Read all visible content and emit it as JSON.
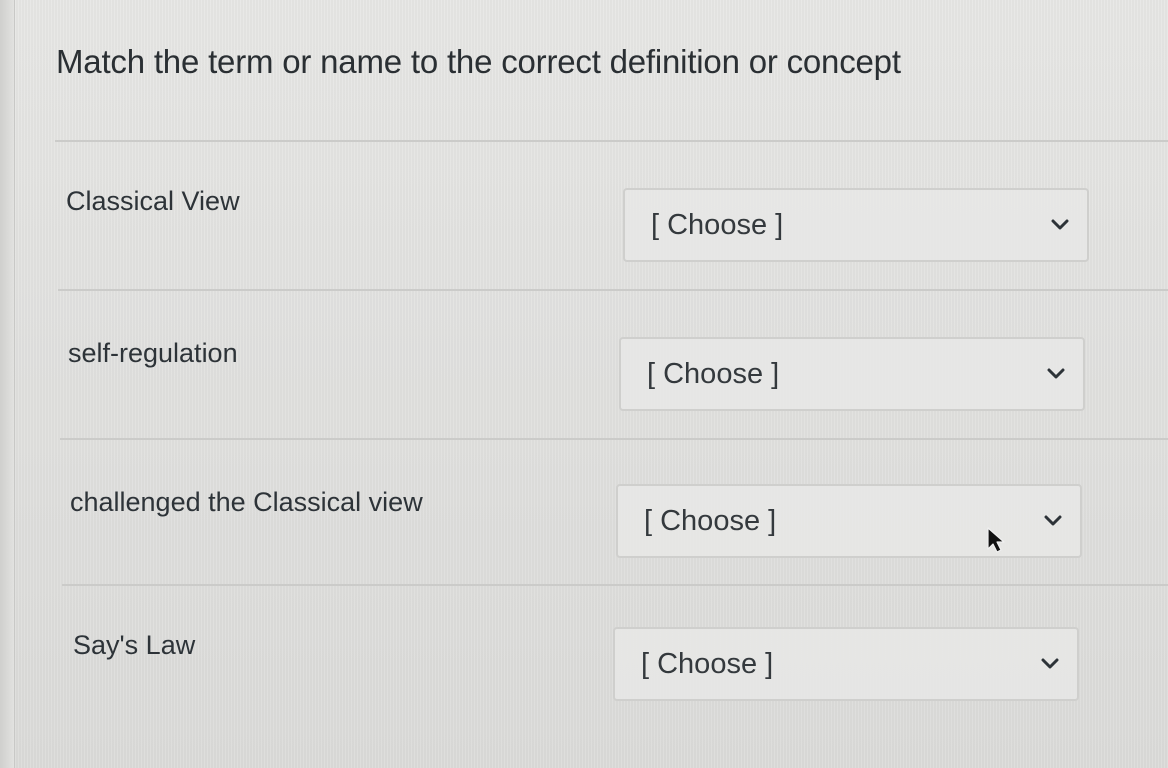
{
  "question": {
    "prompt": "Match the term or name to the correct definition or concept"
  },
  "rows": [
    {
      "term": "Classical View",
      "select_value": "[ Choose ]"
    },
    {
      "term": "self-regulation",
      "select_value": "[ Choose ]"
    },
    {
      "term": "challenged the Classical view",
      "select_value": "[ Choose ]"
    },
    {
      "term": "Say's Law",
      "select_value": "[ Choose ]"
    }
  ],
  "icons": {
    "dropdown": "chevron-down-icon",
    "pointer": "mouse-cursor-icon"
  }
}
